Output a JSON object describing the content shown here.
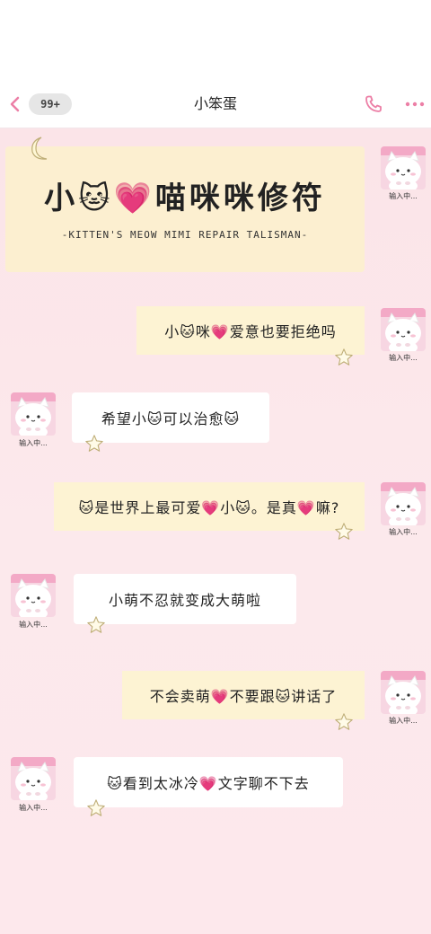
{
  "header": {
    "unread_badge": "99+",
    "title": "小笨蛋"
  },
  "icons": {
    "back": "chevron-left-icon",
    "phone": "phone-icon",
    "more": "more-dots-icon",
    "moon": "crescent-moon-icon",
    "star": "star-icon",
    "avatar": "white-cat-avatar"
  },
  "colors": {
    "accent": "#ec7fa6",
    "chat_bg": "#fbe4e8",
    "cream_bubble": "#fdf3d3",
    "white_bubble": "#ffffff"
  },
  "card": {
    "title": "小🐱💗喵咪咪修符",
    "subtitle": "-KITTEN'S MEOW MIMI REPAIR TALISMAN-"
  },
  "messages": [
    {
      "side": "right",
      "text": "小🐱咪💗爱意也要拒绝吗",
      "avatar_caption": "输入中..."
    },
    {
      "side": "left",
      "text": "希望小🐱可以治愈🐱",
      "avatar_caption": "输入中..."
    },
    {
      "side": "right",
      "text": "🐱是世界上最可爱💗小🐱。是真💗嘛?",
      "avatar_caption": "输入中..."
    },
    {
      "side": "left",
      "text": "小萌不忍就变成大萌啦",
      "avatar_caption": "输入中..."
    },
    {
      "side": "right",
      "text": "不会卖萌💗不要跟🐱讲话了",
      "avatar_caption": "输入中..."
    },
    {
      "side": "left",
      "text": "🐱看到太冰冷💗文字聊不下去",
      "avatar_caption": "输入中..."
    }
  ],
  "card_avatar_caption": "输入中..."
}
